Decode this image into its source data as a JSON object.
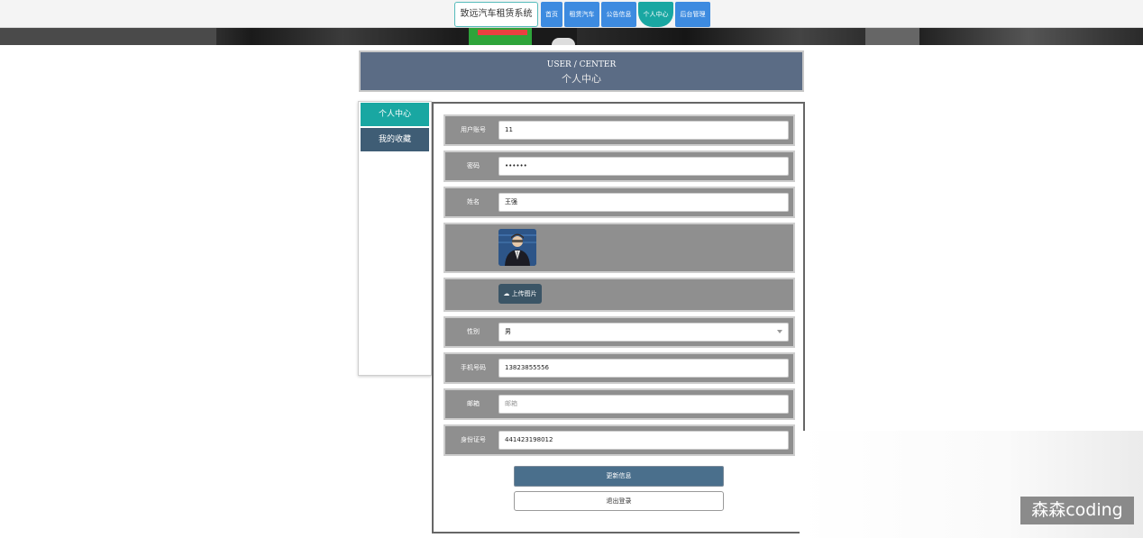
{
  "app": {
    "site_title": "致远汽车租赁系统",
    "nav": [
      {
        "label": "首页"
      },
      {
        "label": "租赁汽车"
      },
      {
        "label": "公告信息"
      },
      {
        "label": "个人中心"
      },
      {
        "label": "后台管理"
      }
    ],
    "active_nav": "个人中心"
  },
  "header": {
    "title_en": "USER / CENTER",
    "title_cn": "个人中心"
  },
  "sidebar": {
    "items": [
      {
        "label": "个人中心"
      },
      {
        "label": "我的收藏"
      }
    ]
  },
  "form": {
    "username": {
      "label": "用户账号",
      "value": "11"
    },
    "password": {
      "label": "密码",
      "value": "••••••"
    },
    "name": {
      "label": "姓名",
      "value": "王强"
    },
    "upload": {
      "label": "上传图片"
    },
    "gender": {
      "label": "性别",
      "value": "男"
    },
    "phone": {
      "label": "手机号码",
      "value": "13823855556"
    },
    "email": {
      "label": "邮箱",
      "value": "邮箱"
    },
    "id_card": {
      "label": "身份证号",
      "value": "441423198012"
    },
    "update_button": "更新信息",
    "logout_button": "退出登录"
  },
  "watermark": "森森coding",
  "colors": {
    "nav_blue": "#3d8be0",
    "nav_active": "#19a7a2",
    "header_bg": "#5b6c85",
    "row_bg": "#8f8f8f",
    "update_btn": "#4a6f8c"
  }
}
